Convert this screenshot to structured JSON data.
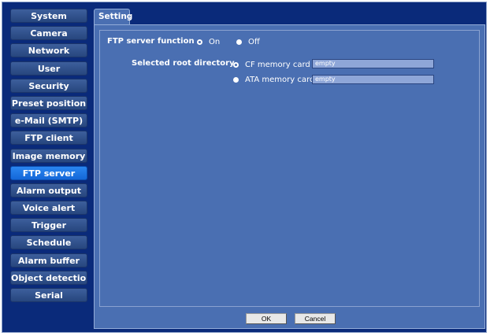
{
  "sidebar": {
    "items": [
      {
        "label": "System"
      },
      {
        "label": "Camera"
      },
      {
        "label": "Network"
      },
      {
        "label": "User"
      },
      {
        "label": "Security"
      },
      {
        "label": "Preset position"
      },
      {
        "label": "e-Mail (SMTP)"
      },
      {
        "label": "FTP client"
      },
      {
        "label": "Image memory"
      },
      {
        "label": "FTP server"
      },
      {
        "label": "Alarm output"
      },
      {
        "label": "Voice alert"
      },
      {
        "label": "Trigger"
      },
      {
        "label": "Schedule"
      },
      {
        "label": "Alarm buffer"
      },
      {
        "label": "Object detection"
      },
      {
        "label": "Serial"
      }
    ],
    "active": "FTP server"
  },
  "tab": {
    "label": "Setting"
  },
  "form": {
    "ftp_function": {
      "label": "FTP server function",
      "on_label": "On",
      "off_label": "Off",
      "selected": "On"
    },
    "root_dir": {
      "label": "Selected root directory",
      "cf_label": "CF memory card",
      "cf_value": "empty",
      "ata_label": "ATA memory card",
      "ata_value": "empty",
      "selected": "CF memory card"
    }
  },
  "buttons": {
    "ok": "OK",
    "cancel": "Cancel"
  },
  "colors": {
    "background": "#0a2a7a",
    "panel": "#4a6fb2",
    "active_item": "#1e78e8"
  }
}
